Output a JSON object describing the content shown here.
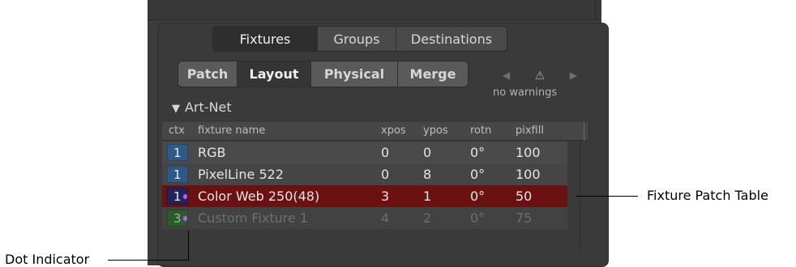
{
  "top_tabs": [
    {
      "label": "Fixtures",
      "active": true
    },
    {
      "label": "Groups",
      "active": false
    },
    {
      "label": "Destinations",
      "active": false
    }
  ],
  "sub_tabs": [
    {
      "label": "Patch",
      "active": false
    },
    {
      "label": "Layout",
      "active": true
    },
    {
      "label": "Physical",
      "active": false
    },
    {
      "label": "Merge",
      "active": false
    }
  ],
  "warnings": {
    "left_arrow_icon": "triangle-left-icon",
    "warning_icon": "warning-triangle-icon",
    "right_arrow_icon": "triangle-right-icon",
    "text": "no warnings"
  },
  "section": {
    "title": "Art-Net",
    "expander_icon": "triangle-down-icon"
  },
  "table": {
    "headers": [
      "ctx",
      "fixture name",
      "xpos",
      "ypos",
      "rotn",
      "pixfill"
    ],
    "rows": [
      {
        "ctx": "1",
        "name": "RGB",
        "xpos": "0",
        "ypos": "0",
        "rotn": "0°",
        "pixfill": "100",
        "selected": false,
        "dimmed": false
      },
      {
        "ctx": "1",
        "name": "PixelLine 522",
        "xpos": "0",
        "ypos": "8",
        "rotn": "0°",
        "pixfill": "100",
        "selected": false,
        "dimmed": false
      },
      {
        "ctx": "1",
        "name": "Color Web 250(48)",
        "xpos": "3",
        "ypos": "1",
        "rotn": "0°",
        "pixfill": "50",
        "selected": true,
        "dimmed": false
      },
      {
        "ctx": "3",
        "name": "Custom Fixture 1",
        "xpos": "4",
        "ypos": "2",
        "rotn": "0°",
        "pixfill": "75",
        "selected": false,
        "dimmed": true
      }
    ]
  },
  "annotations": {
    "fixture_patch_table": "Fixture Patch Table",
    "dot_indicator": "Dot Indicator"
  },
  "colors": {
    "selected_row": "#6b1111",
    "ctx_blue": "#2d5a86",
    "ctx_green": "#2d5a2d",
    "dot_purple": "#b15fff"
  }
}
